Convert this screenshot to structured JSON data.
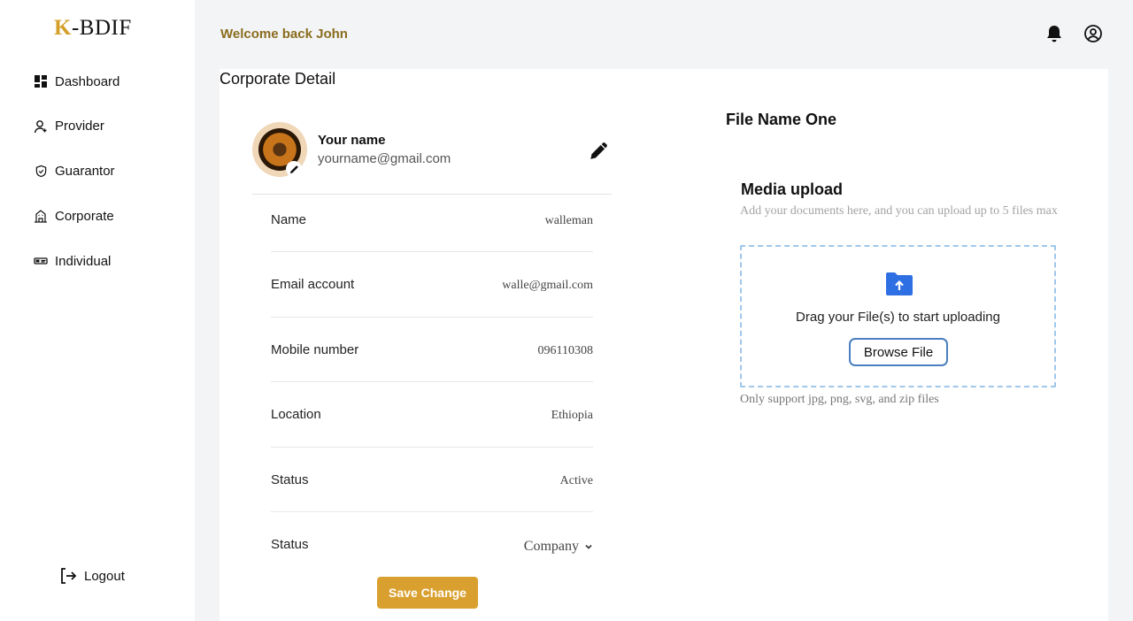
{
  "app": {
    "logo_initial": "K",
    "logo_rest": "-BDIF",
    "accent_color": "#d9a02f"
  },
  "sidebar": {
    "items": [
      {
        "label": "Dashboard",
        "icon": "dashboard-icon"
      },
      {
        "label": "Provider",
        "icon": "user-plus-icon"
      },
      {
        "label": "Guarantor",
        "icon": "shield-check-icon"
      },
      {
        "label": "Corporate",
        "icon": "building-icon"
      },
      {
        "label": "Individual",
        "icon": "id-card-icon"
      }
    ],
    "logout_label": "Logout"
  },
  "header": {
    "welcome": "Welcome back John",
    "icons": [
      "bell-icon",
      "user-circle-icon"
    ]
  },
  "main": {
    "title": "Corporate Detail",
    "profile": {
      "name": "Your name",
      "email": "yourname@gmail.com"
    },
    "fields": [
      {
        "label": "Name",
        "value": "walleman"
      },
      {
        "label": "Email account",
        "value": "walle@gmail.com"
      },
      {
        "label": "Mobile number",
        "value": "096110308"
      },
      {
        "label": "Location",
        "value": "Ethiopia"
      },
      {
        "label": "Status",
        "value": "Active"
      },
      {
        "label": "Status",
        "value": "Company"
      }
    ],
    "save_label": "Save Change"
  },
  "upload": {
    "file_name": "File Name One",
    "title": "Media upload",
    "subtitle": "Add your documents here, and you can upload up to 5 files max",
    "drag_text": "Drag your File(s) to start uploading",
    "browse_label": "Browse File",
    "support_text": "Only support jpg, png, svg, and zip files"
  }
}
